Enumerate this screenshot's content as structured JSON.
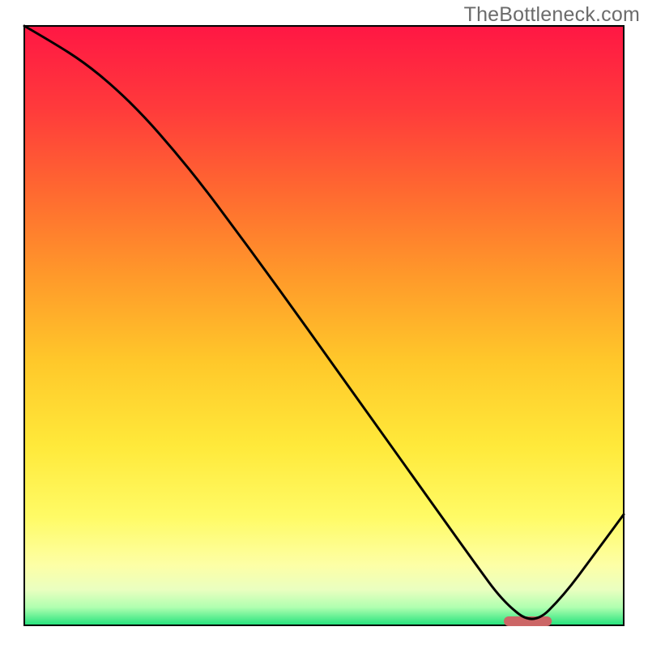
{
  "watermark": "TheBottleneck.com",
  "chart_data": {
    "type": "line",
    "title": "",
    "xlabel": "",
    "ylabel": "",
    "xlim": [
      0,
      100
    ],
    "ylim": [
      0,
      100
    ],
    "x": [
      0,
      5,
      10,
      15,
      20,
      25,
      30,
      35,
      40,
      45,
      50,
      55,
      60,
      65,
      70,
      75,
      80,
      85,
      90,
      95,
      100
    ],
    "values": [
      100.0,
      97.1,
      93.9,
      89.8,
      84.9,
      79.2,
      73.0,
      66.3,
      59.5,
      52.6,
      45.6,
      38.6,
      31.6,
      24.6,
      17.6,
      10.6,
      3.8,
      0.0,
      5.0,
      11.7,
      18.5
    ],
    "optimum_x_range": [
      80,
      88
    ],
    "optimum_marker_color": "#cc6666",
    "line_color": "#000000",
    "background_gradient": {
      "type": "vertical",
      "stops": [
        {
          "pct": 0,
          "color": "#ff1744"
        },
        {
          "pct": 14,
          "color": "#ff3b3b"
        },
        {
          "pct": 28,
          "color": "#ff6a30"
        },
        {
          "pct": 42,
          "color": "#ff9a2a"
        },
        {
          "pct": 56,
          "color": "#ffc82a"
        },
        {
          "pct": 70,
          "color": "#ffe93a"
        },
        {
          "pct": 82,
          "color": "#fffb66"
        },
        {
          "pct": 90,
          "color": "#fdffa6"
        },
        {
          "pct": 94,
          "color": "#eaffc0"
        },
        {
          "pct": 97,
          "color": "#b0ffb0"
        },
        {
          "pct": 100,
          "color": "#21e27b"
        }
      ]
    }
  }
}
